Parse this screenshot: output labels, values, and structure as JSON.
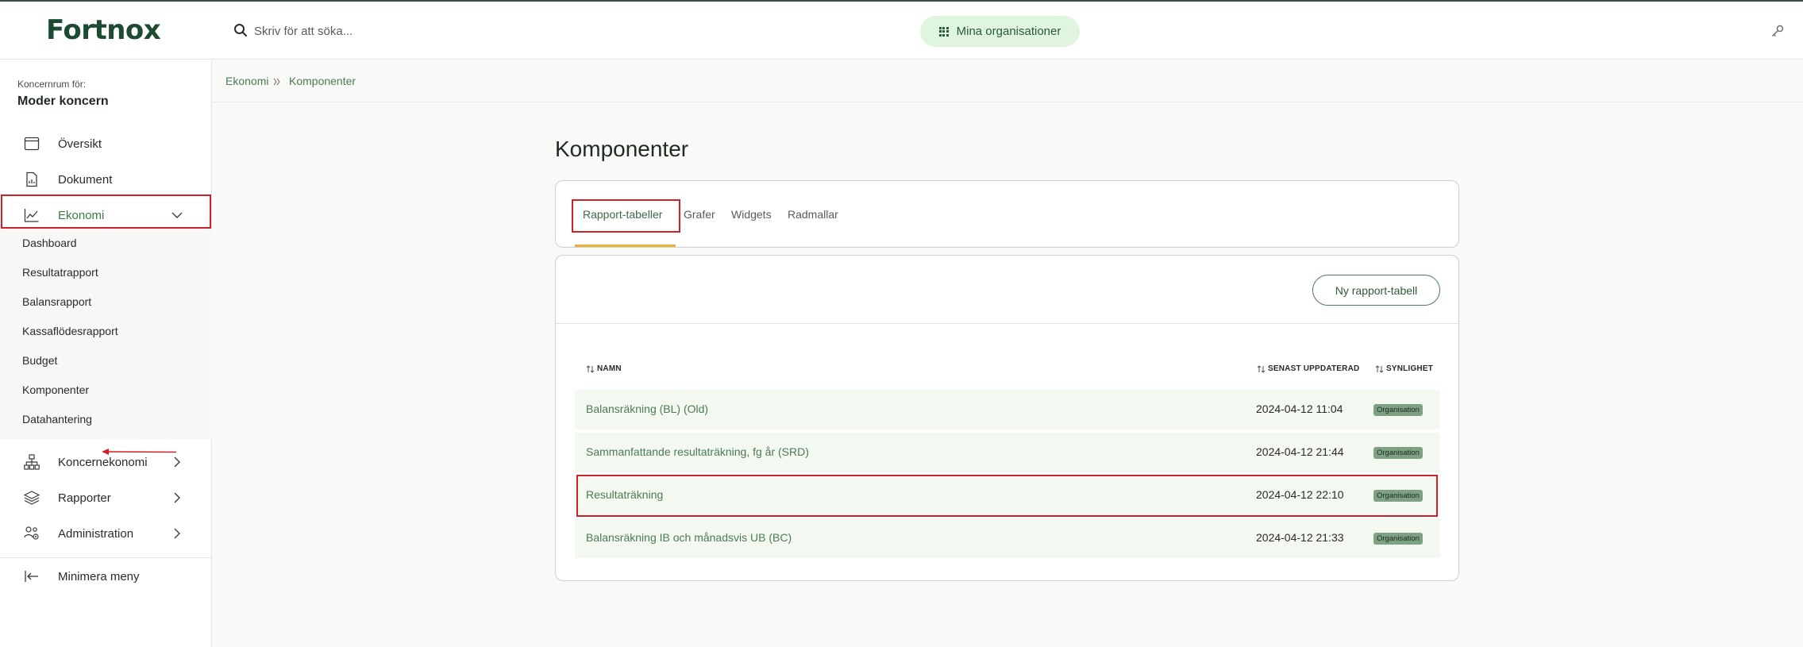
{
  "header": {
    "logo": "Fortnox",
    "search_placeholder": "Skriv för att söka...",
    "org_button": "Mina organisationer"
  },
  "sidebar": {
    "caption": "Koncernrum för:",
    "title": "Moder koncern",
    "items": [
      {
        "label": "Översikt",
        "icon": "window-icon"
      },
      {
        "label": "Dokument",
        "icon": "document-icon"
      },
      {
        "label": "Ekonomi",
        "icon": "chart-line-icon"
      },
      {
        "label": "Koncernekonomi",
        "icon": "hierarchy-icon"
      },
      {
        "label": "Rapporter",
        "icon": "layers-icon"
      },
      {
        "label": "Administration",
        "icon": "users-settings-icon"
      }
    ],
    "sub_items": [
      "Dashboard",
      "Resultatrapport",
      "Balansrapport",
      "Kassaflödesrapport",
      "Budget",
      "Komponenter",
      "Datahantering"
    ],
    "minimize": "Minimera meny"
  },
  "breadcrumb": [
    "Ekonomi",
    "Komponenter"
  ],
  "main": {
    "title": "Komponenter",
    "tabs": [
      "Rapport-tabeller",
      "Grafer",
      "Widgets",
      "Radmallar"
    ],
    "new_button": "Ny rapport-tabell",
    "columns": [
      "NAMN",
      "SENAST UPPDATERAD",
      "SYNLIGHET"
    ],
    "rows": [
      {
        "name": "Balansräkning (BL) (Old)",
        "updated": "2024-04-12 11:04",
        "visibility": "Organisation"
      },
      {
        "name": "Sammanfattande resultaträkning, fg år (SRD)",
        "updated": "2024-04-12 21:44",
        "visibility": "Organisation"
      },
      {
        "name": "Resultaträkning",
        "updated": "2024-04-12 22:10",
        "visibility": "Organisation"
      },
      {
        "name": "Balansräkning IB och månadsvis UB (BC)",
        "updated": "2024-04-12 21:33",
        "visibility": "Organisation"
      }
    ]
  },
  "colors": {
    "brand": "#1c4b31",
    "accent_green": "#4c7a55",
    "tab_underline": "#e8b23c",
    "highlight_red": "#d0202a",
    "badge": "#7ea183"
  }
}
